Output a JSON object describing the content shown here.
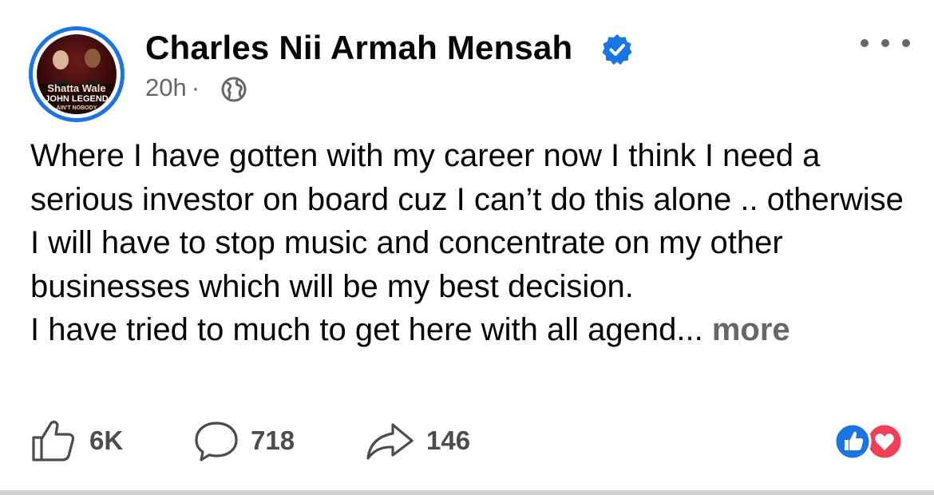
{
  "post": {
    "author": "Charles Nii Armah Mensah",
    "verified": true,
    "time": "20h",
    "separator": "·",
    "audience_icon": "globe-icon",
    "avatar_text": {
      "line1": "Shatta Wale",
      "line2": "JOHN LEGEND",
      "line3": "AIN'T NOBODY"
    },
    "body_paragraphs": [
      "Where I have gotten with my career now I think I need a serious investor on board cuz I can’t do this alone .. otherwise I will have to stop music and concentrate on my other businesses which will be my best decision.",
      "I have tried to much to get here with all agend..."
    ],
    "see_more_label": "more"
  },
  "actions": {
    "likes": "6K",
    "comments": "718",
    "shares": "146"
  },
  "colors": {
    "accent": "#1b74e4",
    "secondary_text": "#65676b",
    "love": "#f33e58"
  }
}
